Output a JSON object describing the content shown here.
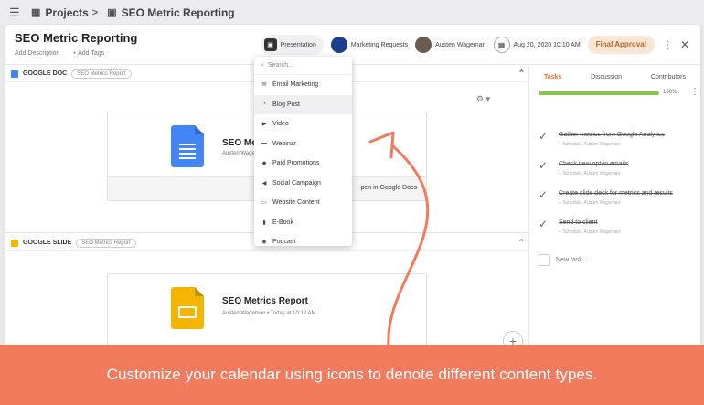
{
  "topbar": {
    "breadcrumb_root": "Projects",
    "breadcrumb_current": "SEO Metric Reporting",
    "help": "?",
    "apps": "⁞⁞"
  },
  "header": {
    "title": "SEO Metric Reporting",
    "add_description": "Add Description",
    "add_tags": "+ Add Tags",
    "content_type": "Presentation",
    "team": "Marketing Requests",
    "assignee": "Austen Wageman",
    "due_date": "Aug 20, 2020 10:10 AM",
    "status": "Final Approval",
    "status_color": "#c0641f"
  },
  "sections": [
    {
      "label": "GOOGLE DOC",
      "tag": "SEO Metrics Report",
      "file_name": "SEO Me",
      "file_meta": "Austen Wagem",
      "open_label": "pen in Google Docs"
    },
    {
      "label": "GOOGLE SLIDE",
      "tag": "SEO Metrics Report",
      "file_name": "SEO Metrics Report",
      "file_meta": "Austen Wageman  •  Today at 10:12 AM"
    }
  ],
  "dropdown": {
    "search_placeholder": "Search...",
    "options": [
      {
        "label": "Email Marketing",
        "icon": "email-icon"
      },
      {
        "label": "Blog Post",
        "icon": "rss-icon"
      },
      {
        "label": "Video",
        "icon": "video-icon"
      },
      {
        "label": "Webinar",
        "icon": "webinar-icon"
      },
      {
        "label": "Paid Promotions",
        "icon": "tag-icon"
      },
      {
        "label": "Social Campaign",
        "icon": "megaphone-icon"
      },
      {
        "label": "Website Content",
        "icon": "monitor-icon"
      },
      {
        "label": "E-Book",
        "icon": "book-icon"
      },
      {
        "label": "Podcast",
        "icon": "podcast-icon"
      }
    ],
    "selected": "Blog Post"
  },
  "panel": {
    "tabs": [
      "Tasks",
      "Discussion",
      "Contributors"
    ],
    "active_tab": "Tasks",
    "progress_label": "100%",
    "progress": 1.0,
    "progress_color": "#8bc34a",
    "tasks": [
      {
        "text": "Gather metrics from Google Analytics",
        "meta": "+ Schedule,  Austen Wageman"
      },
      {
        "text": "Check new opt-in emails",
        "meta": "+ Schedule,  Austen Wageman"
      },
      {
        "text": "Create slide deck for metrics and results",
        "meta": "+ Schedule,  Austen Wageman"
      },
      {
        "text": "Send to client",
        "meta": "+ Schedule,  Austen Wageman"
      }
    ],
    "new_task_placeholder": "New task..."
  },
  "banner": {
    "text": "Customize your calendar using icons to denote different content types.",
    "color": "#f27b5e"
  }
}
